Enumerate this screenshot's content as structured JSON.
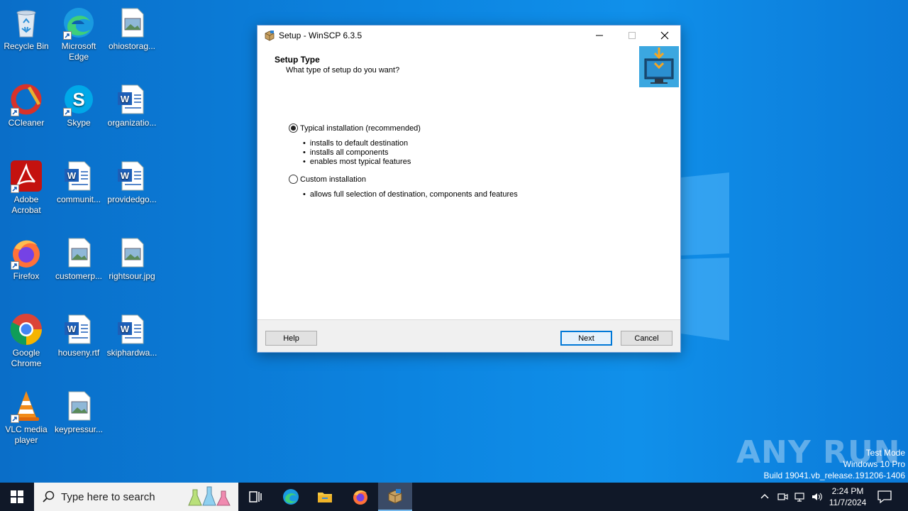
{
  "desktop": {
    "icons": [
      {
        "label": "Recycle Bin",
        "icon": "recycle-bin-icon"
      },
      {
        "label": "Microsoft Edge",
        "icon": "edge-icon"
      },
      {
        "label": "ohiostorag...",
        "icon": "image-file-icon"
      },
      {
        "label": "CCleaner",
        "icon": "ccleaner-icon"
      },
      {
        "label": "Skype",
        "icon": "skype-icon"
      },
      {
        "label": "organizatio...",
        "icon": "word-file-icon"
      },
      {
        "label": "Adobe Acrobat",
        "icon": "acrobat-icon"
      },
      {
        "label": "communit...",
        "icon": "word-file-icon"
      },
      {
        "label": "providedgo...",
        "icon": "word-file-icon"
      },
      {
        "label": "Firefox",
        "icon": "firefox-icon"
      },
      {
        "label": "customerp...",
        "icon": "image-file-icon"
      },
      {
        "label": "rightsour.jpg",
        "icon": "image-file-icon"
      },
      {
        "label": "Google Chrome",
        "icon": "chrome-icon"
      },
      {
        "label": "houseny.rtf",
        "icon": "word-file-icon"
      },
      {
        "label": "skiphardwa...",
        "icon": "word-file-icon"
      },
      {
        "label": "VLC media player",
        "icon": "vlc-icon"
      },
      {
        "label": "keypressur...",
        "icon": "image-file-icon"
      }
    ]
  },
  "dialog": {
    "title": "Setup - WinSCP 6.3.5",
    "header_title": "Setup Type",
    "header_subtitle": "What type of setup do you want?",
    "options": [
      {
        "label": "Typical installation (recommended)",
        "checked": true,
        "bullets": [
          "installs to default destination",
          "installs all components",
          "enables most typical features"
        ]
      },
      {
        "label": "Custom installation",
        "checked": false,
        "bullets": [
          "allows full selection of destination, components and features"
        ]
      }
    ],
    "buttons": {
      "help": "Help",
      "next": "Next",
      "cancel": "Cancel"
    }
  },
  "watermark": {
    "brand": "ANY RUN",
    "line1": "Test Mode",
    "line2": "Windows 10 Pro",
    "line3": "Build 19041.vb_release.191206-1406"
  },
  "taskbar": {
    "search_placeholder": "Type here to search",
    "clock_time": "2:24 PM",
    "clock_date": "11/7/2024"
  },
  "colors": {
    "desktop_bg": "#0a7ad6",
    "taskbar_bg": "#101828",
    "accent": "#0078d7"
  }
}
